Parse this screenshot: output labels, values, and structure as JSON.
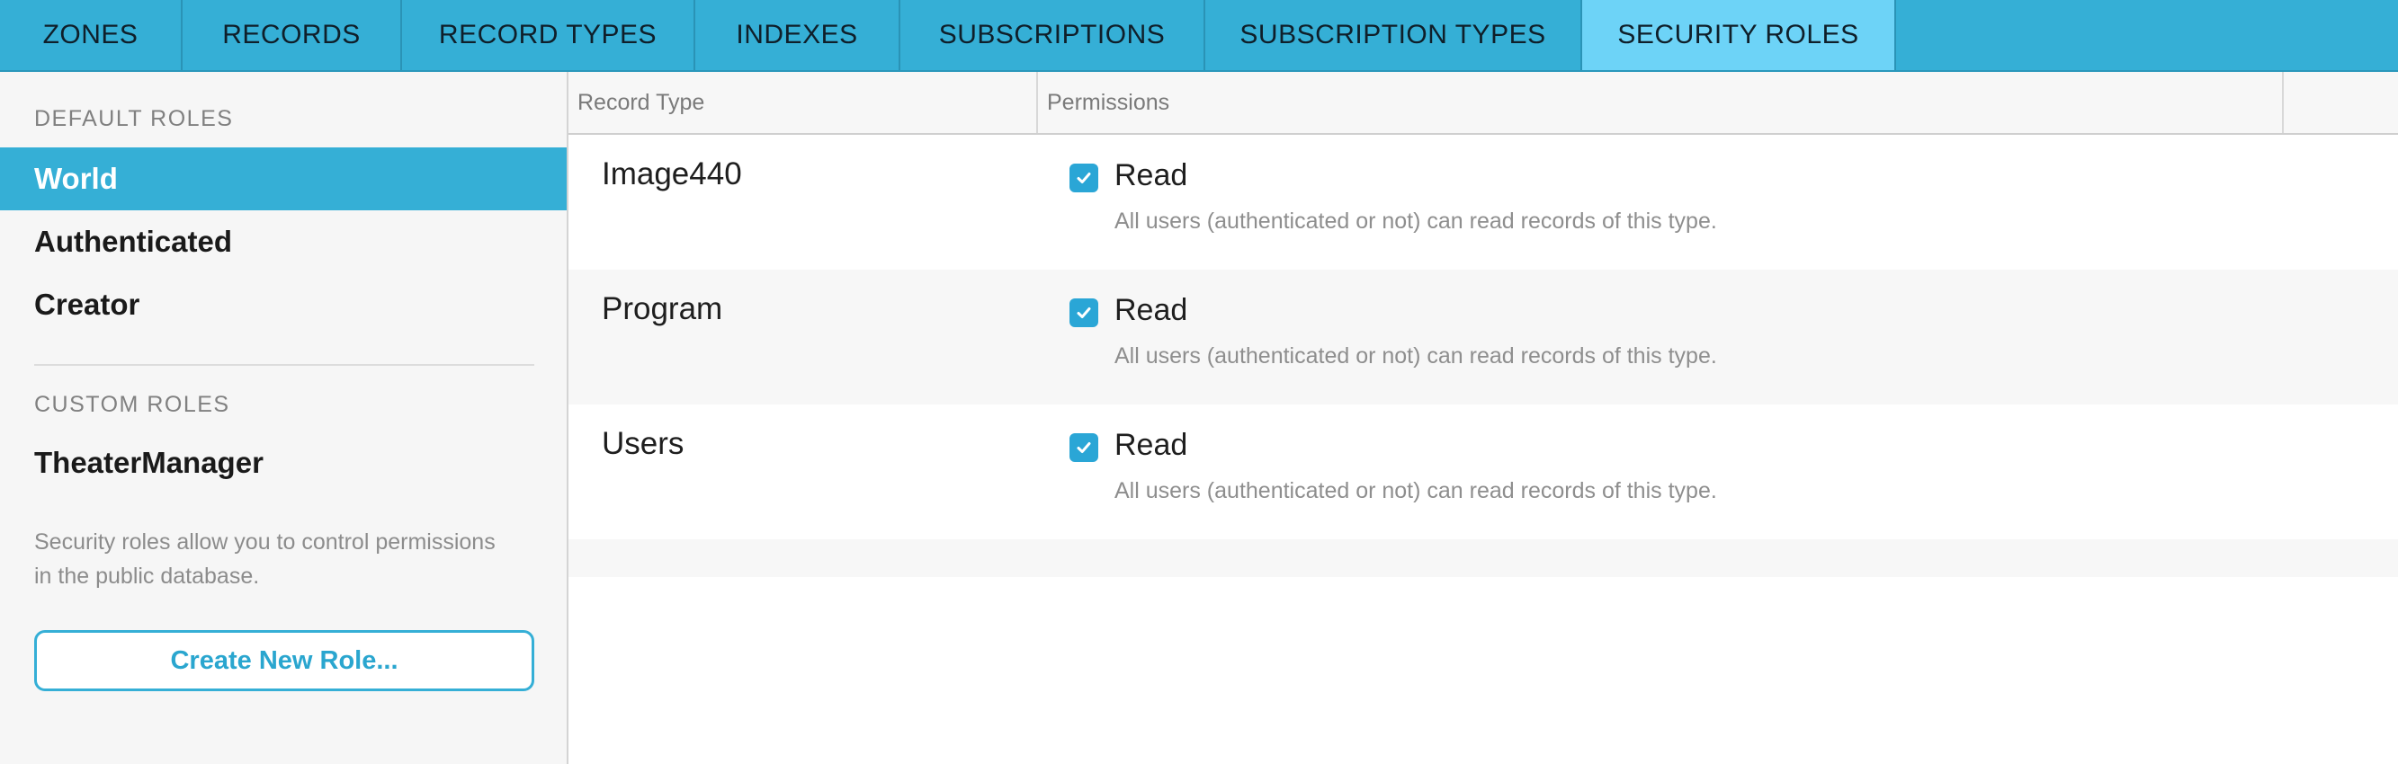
{
  "tabs": [
    {
      "label": "ZONES",
      "active": false
    },
    {
      "label": "RECORDS",
      "active": false
    },
    {
      "label": "RECORD TYPES",
      "active": false
    },
    {
      "label": "INDEXES",
      "active": false
    },
    {
      "label": "SUBSCRIPTIONS",
      "active": false
    },
    {
      "label": "SUBSCRIPTION TYPES",
      "active": false
    },
    {
      "label": "SECURITY ROLES",
      "active": true
    }
  ],
  "sidebar": {
    "default_heading": "DEFAULT ROLES",
    "default_roles": [
      {
        "label": "World",
        "selected": true
      },
      {
        "label": "Authenticated",
        "selected": false
      },
      {
        "label": "Creator",
        "selected": false
      }
    ],
    "custom_heading": "CUSTOM ROLES",
    "custom_roles": [
      {
        "label": "TheaterManager",
        "selected": false
      }
    ],
    "help_text": "Security roles allow you to control permissions in the public database.",
    "create_button_label": "Create New Role..."
  },
  "table": {
    "columns": [
      "Record Type",
      "Permissions"
    ],
    "rows": [
      {
        "record_type": "Image440",
        "permission": {
          "label": "Read",
          "checked": true
        },
        "description": "All users (authenticated or not) can read records of this type."
      },
      {
        "record_type": "Program",
        "permission": {
          "label": "Read",
          "checked": true
        },
        "description": "All users (authenticated or not) can read records of this type."
      },
      {
        "record_type": "Users",
        "permission": {
          "label": "Read",
          "checked": true
        },
        "description": "All users (authenticated or not) can read records of this type."
      }
    ]
  },
  "colors": {
    "accent": "#35afd6",
    "active_tab": "#6dd3f7",
    "checkbox": "#2aa6d6"
  },
  "icons": {
    "checkbox_checked": "checkmark-icon"
  }
}
